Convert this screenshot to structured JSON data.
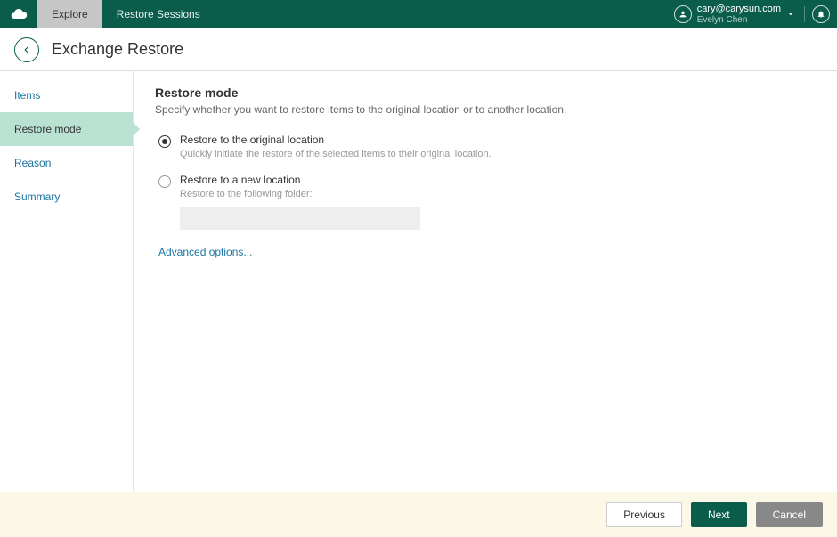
{
  "topbar": {
    "tabs": [
      {
        "label": "Explore",
        "active": true
      },
      {
        "label": "Restore Sessions",
        "active": false
      }
    ],
    "user_email": "cary@carysun.com",
    "user_display": "Evelyn Chen"
  },
  "header": {
    "title": "Exchange Restore"
  },
  "sidebar": {
    "steps": [
      {
        "label": "Items",
        "current": false
      },
      {
        "label": "Restore mode",
        "current": true
      },
      {
        "label": "Reason",
        "current": false
      },
      {
        "label": "Summary",
        "current": false
      }
    ]
  },
  "main": {
    "heading": "Restore mode",
    "description": "Specify whether you want to restore items to the original location or to another location.",
    "options": [
      {
        "label": "Restore to the original location",
        "hint": "Quickly initiate the restore of the selected items to their original location.",
        "selected": true
      },
      {
        "label": "Restore to a new location",
        "hint": "Restore to the following folder:",
        "selected": false
      }
    ],
    "folder_value": "",
    "advanced_link": "Advanced options..."
  },
  "footer": {
    "previous": "Previous",
    "next": "Next",
    "cancel": "Cancel"
  }
}
